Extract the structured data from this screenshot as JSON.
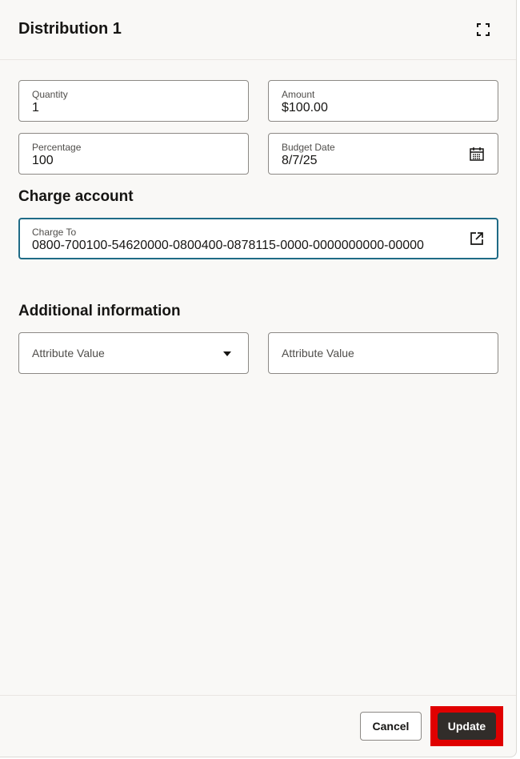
{
  "header": {
    "title": "Distribution 1"
  },
  "fields": {
    "quantity": {
      "label": "Quantity",
      "value": "1"
    },
    "amount": {
      "label": "Amount",
      "value": "$100.00"
    },
    "percentage": {
      "label": "Percentage",
      "value": "100"
    },
    "budget_date": {
      "label": "Budget Date",
      "value": "8/7/25"
    }
  },
  "charge_account": {
    "heading": "Charge account",
    "label": "Charge To",
    "value": "0800-700100-54620000-0800400-0878115-0000-0000000000-00000"
  },
  "additional": {
    "heading": "Additional information",
    "attr1_placeholder": "Attribute Value",
    "attr2_placeholder": "Attribute Value"
  },
  "footer": {
    "cancel_label": "Cancel",
    "update_label": "Update"
  },
  "colors": {
    "focus_border": "#1f6b86",
    "primary_button": "#312d2a",
    "highlight": "#e00000"
  }
}
